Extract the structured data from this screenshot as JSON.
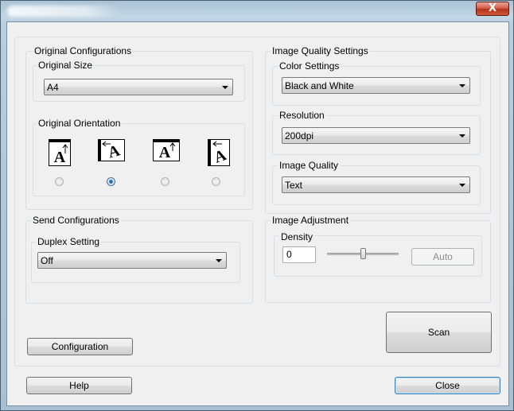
{
  "window": {
    "close_glyph": "X"
  },
  "original_configurations": {
    "title": "Original Configurations",
    "original_size": {
      "label": "Original Size",
      "value": "A4"
    },
    "orientation": {
      "label": "Original Orientation",
      "glyph": "A",
      "selected_index": 1,
      "options": [
        "portrait-top",
        "landscape-left",
        "portrait-top-alt",
        "landscape-right"
      ]
    }
  },
  "send_configurations": {
    "title": "Send Configurations",
    "duplex": {
      "label": "Duplex Setting",
      "value": "Off"
    }
  },
  "image_quality_settings": {
    "title": "Image Quality Settings",
    "color": {
      "label": "Color Settings",
      "value": "Black and White"
    },
    "resolution": {
      "label": "Resolution",
      "value": "200dpi"
    },
    "quality": {
      "label": "Image Quality",
      "value": "Text"
    }
  },
  "image_adjustment": {
    "title": "Image Adjustment",
    "density": {
      "label": "Density",
      "value": "0",
      "auto_label": "Auto",
      "slider_fraction": 0.5
    }
  },
  "buttons": {
    "scan": "Scan",
    "configuration": "Configuration",
    "help": "Help",
    "close": "Close"
  },
  "colors": {
    "client_bg": "#f0f0f0",
    "frame": "#a8c0d2",
    "close_red": "#c8462c"
  }
}
